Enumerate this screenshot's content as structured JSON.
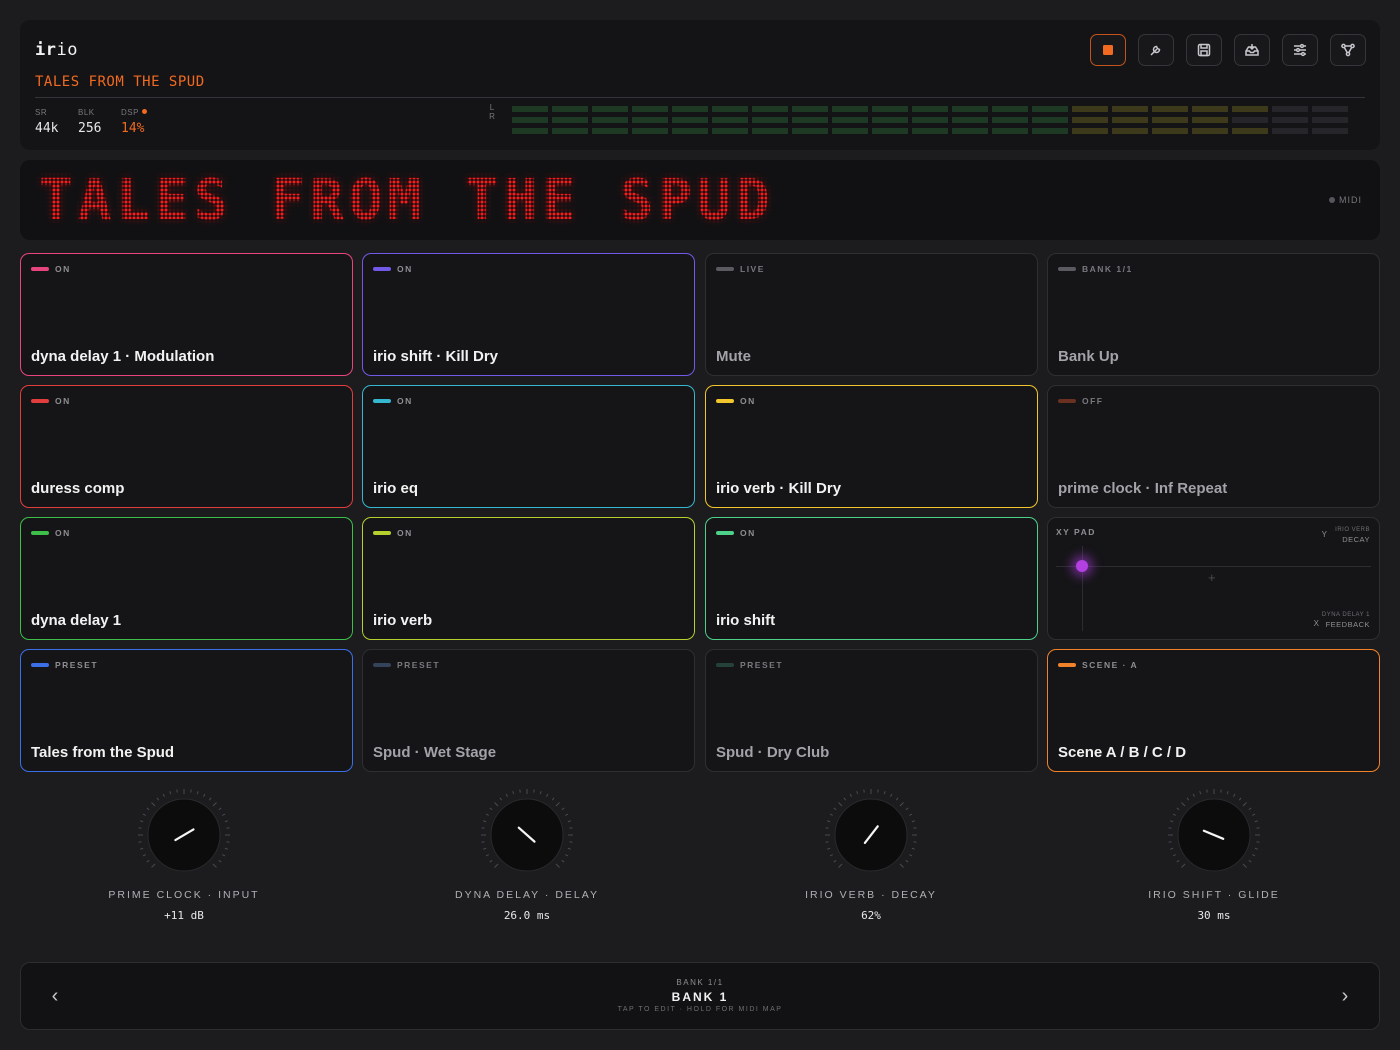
{
  "app": {
    "logo": "irio",
    "subtitle": "TALES FROM THE SPUD"
  },
  "stats": [
    {
      "label": "SR",
      "value": "44k"
    },
    {
      "label": "BLK",
      "value": "256"
    },
    {
      "label": "DSP",
      "value": "14%"
    }
  ],
  "meters": {
    "left_label": "L",
    "right_label": "R",
    "left_level": 0.86,
    "right_level": 0.84
  },
  "toolbar": {
    "stop": "stop-icon",
    "tune": "wrench-icon",
    "save": "save-icon",
    "inbox": "inbox-icon",
    "settings": "sliders-icon",
    "routing": "nodes-icon"
  },
  "display": {
    "text": "TALES FROM THE SPUD",
    "midi": "MIDI"
  },
  "pads": [
    {
      "status": "ON",
      "name": "dyna delay 1 · Modulation",
      "color": "#e8457f",
      "active": true
    },
    {
      "status": "ON",
      "name": "irio shift · Kill Dry",
      "color": "#7259e8",
      "active": true
    },
    {
      "status": "LIVE",
      "name": "Mute",
      "color": "#5a5a60",
      "active": false
    },
    {
      "status": "BANK 1/1",
      "name": "Bank Up",
      "color": "#5a5a60",
      "active": false
    },
    {
      "status": "ON",
      "name": "duress comp",
      "color": "#e23d3d",
      "active": true
    },
    {
      "status": "ON",
      "name": "irio eq",
      "color": "#35b7cf",
      "active": true
    },
    {
      "status": "ON",
      "name": "irio verb · Kill Dry",
      "color": "#f2c62c",
      "active": true
    },
    {
      "status": "OFF",
      "name": "prime clock · Inf Repeat",
      "color": "#6a3020",
      "active": false
    },
    {
      "status": "ON",
      "name": "dyna delay 1",
      "color": "#3dbf4a",
      "active": true
    },
    {
      "status": "ON",
      "name": "irio verb",
      "color": "#b6d02e",
      "active": true
    },
    {
      "status": "ON",
      "name": "irio shift",
      "color": "#4dd08a",
      "active": true
    },
    {
      "status": "PRESET",
      "name": "Tales from the Spud",
      "color": "#3a6fe8",
      "active": true
    },
    {
      "status": "PRESET",
      "name": "Spud · Wet Stage",
      "color": "#34425a",
      "active": false
    },
    {
      "status": "PRESET",
      "name": "Spud · Dry Club",
      "color": "#24423a",
      "active": false
    },
    {
      "status": "SCENE · A",
      "name": "Scene A / B / C / D",
      "color": "#f0822a",
      "active": true
    }
  ],
  "xy_pad": {
    "title": "XY PAD",
    "y_axis": "Y",
    "y_param_1": "IRIO VERB",
    "y_param_2": "DECAY",
    "x_axis": "X",
    "x_param_1": "DYNA DELAY 1",
    "x_param_2": "FEEDBACK",
    "x_value": 0.1,
    "y_value": 0.75
  },
  "knobs": [
    {
      "label": "PRIME CLOCK · INPUT",
      "value": "+11 dB",
      "position": 0.72
    },
    {
      "label": "DYNA DELAY · DELAY",
      "value": "26.0 ms",
      "position": 0.32
    },
    {
      "label": "IRIO VERB · DECAY",
      "value": "62%",
      "position": 0.64
    },
    {
      "label": "IRIO SHIFT · GLIDE",
      "value": "30 ms",
      "position": 0.25
    }
  ],
  "bank": {
    "sub": "BANK 1/1",
    "title": "BANK 1",
    "hint": "TAP TO EDIT · HOLD FOR MIDI MAP",
    "prev": "chevron-left-icon",
    "next": "chevron-right-icon"
  }
}
